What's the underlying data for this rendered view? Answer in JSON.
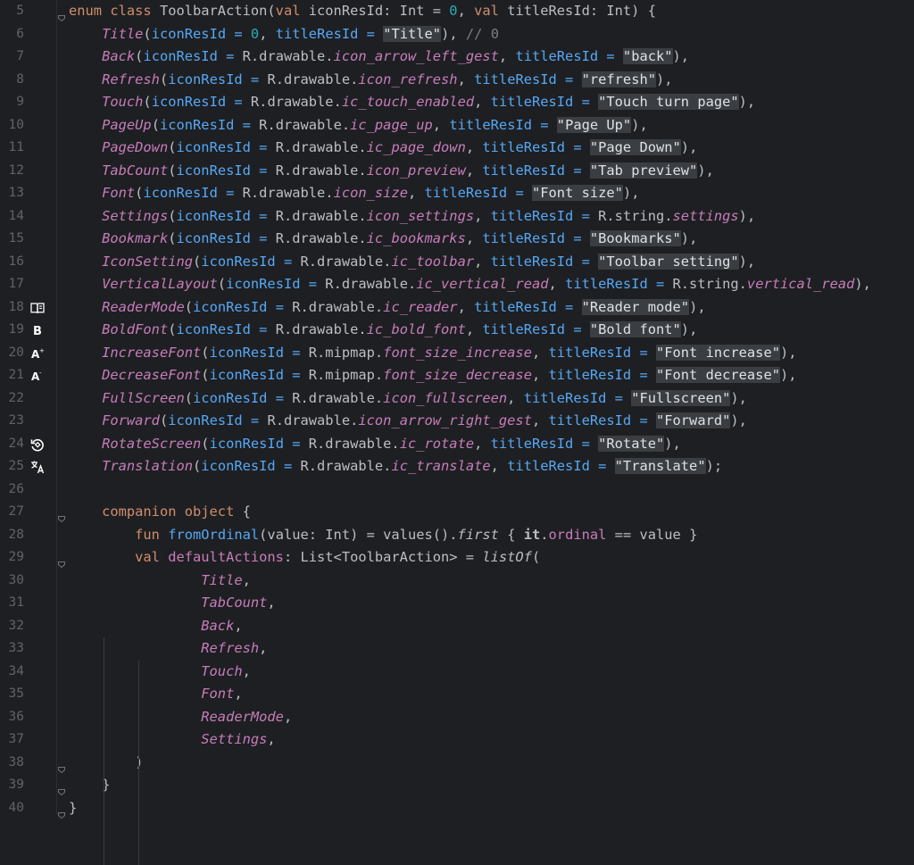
{
  "editor": {
    "lines": [
      {
        "n": "5",
        "fold": true,
        "segs": [
          [
            "kw",
            "enum class "
          ],
          [
            "plain",
            "ToolbarAction("
          ],
          [
            "kw",
            "val "
          ],
          [
            "plain",
            "iconResId: Int = "
          ],
          [
            "num",
            "0"
          ],
          [
            "plain",
            ", "
          ],
          [
            "kw",
            "val "
          ],
          [
            "plain",
            "titleResId: Int) {"
          ]
        ]
      },
      {
        "n": "6",
        "segs": [
          [
            "en",
            "Title"
          ],
          [
            "plain",
            "("
          ],
          [
            "named",
            "iconResId = "
          ],
          [
            "num",
            "0"
          ],
          [
            "plain",
            ", "
          ],
          [
            "named",
            "titleResId = "
          ],
          [
            "strx",
            "\"Title\""
          ],
          [
            "plain",
            "), "
          ],
          [
            "cm",
            "// 0"
          ]
        ]
      },
      {
        "n": "7",
        "segs": [
          [
            "en",
            "Back"
          ],
          [
            "plain",
            "("
          ],
          [
            "named",
            "iconResId = "
          ],
          [
            "plain",
            "R.drawable."
          ],
          [
            "res",
            "icon_arrow_left_gest"
          ],
          [
            "plain",
            ", "
          ],
          [
            "named",
            "titleResId = "
          ],
          [
            "strx",
            "\"back\""
          ],
          [
            "plain",
            "),"
          ]
        ]
      },
      {
        "n": "8",
        "segs": [
          [
            "en",
            "Refresh"
          ],
          [
            "plain",
            "("
          ],
          [
            "named",
            "iconResId = "
          ],
          [
            "plain",
            "R.drawable."
          ],
          [
            "res",
            "icon_refresh"
          ],
          [
            "plain",
            ", "
          ],
          [
            "named",
            "titleResId = "
          ],
          [
            "strx",
            "\"refresh\""
          ],
          [
            "plain",
            "),"
          ]
        ]
      },
      {
        "n": "9",
        "segs": [
          [
            "en",
            "Touch"
          ],
          [
            "plain",
            "("
          ],
          [
            "named",
            "iconResId = "
          ],
          [
            "plain",
            "R.drawable."
          ],
          [
            "res",
            "ic_touch_enabled"
          ],
          [
            "plain",
            ", "
          ],
          [
            "named",
            "titleResId = "
          ],
          [
            "strx",
            "\"Touch turn page\""
          ],
          [
            "plain",
            "),"
          ]
        ]
      },
      {
        "n": "10",
        "segs": [
          [
            "en",
            "PageUp"
          ],
          [
            "plain",
            "("
          ],
          [
            "named",
            "iconResId = "
          ],
          [
            "plain",
            "R.drawable."
          ],
          [
            "res",
            "ic_page_up"
          ],
          [
            "plain",
            ", "
          ],
          [
            "named",
            "titleResId = "
          ],
          [
            "strx",
            "\"Page Up\""
          ],
          [
            "plain",
            "),"
          ]
        ]
      },
      {
        "n": "11",
        "segs": [
          [
            "en",
            "PageDown"
          ],
          [
            "plain",
            "("
          ],
          [
            "named",
            "iconResId = "
          ],
          [
            "plain",
            "R.drawable."
          ],
          [
            "res",
            "ic_page_down"
          ],
          [
            "plain",
            ", "
          ],
          [
            "named",
            "titleResId = "
          ],
          [
            "strx",
            "\"Page Down\""
          ],
          [
            "plain",
            "),"
          ]
        ]
      },
      {
        "n": "12",
        "segs": [
          [
            "en",
            "TabCount"
          ],
          [
            "plain",
            "("
          ],
          [
            "named",
            "iconResId = "
          ],
          [
            "plain",
            "R.drawable."
          ],
          [
            "res",
            "icon_preview"
          ],
          [
            "plain",
            ", "
          ],
          [
            "named",
            "titleResId = "
          ],
          [
            "strx",
            "\"Tab preview\""
          ],
          [
            "plain",
            "),"
          ]
        ]
      },
      {
        "n": "13",
        "segs": [
          [
            "en",
            "Font"
          ],
          [
            "plain",
            "("
          ],
          [
            "named",
            "iconResId = "
          ],
          [
            "plain",
            "R.drawable."
          ],
          [
            "res",
            "icon_size"
          ],
          [
            "plain",
            ", "
          ],
          [
            "named",
            "titleResId = "
          ],
          [
            "strx",
            "\"Font size\""
          ],
          [
            "plain",
            "),"
          ]
        ]
      },
      {
        "n": "14",
        "segs": [
          [
            "en",
            "Settings"
          ],
          [
            "plain",
            "("
          ],
          [
            "named",
            "iconResId = "
          ],
          [
            "plain",
            "R.drawable."
          ],
          [
            "res",
            "icon_settings"
          ],
          [
            "plain",
            ", "
          ],
          [
            "named",
            "titleResId = "
          ],
          [
            "plain",
            "R.string."
          ],
          [
            "res",
            "settings"
          ],
          [
            "plain",
            "),"
          ]
        ]
      },
      {
        "n": "15",
        "segs": [
          [
            "en",
            "Bookmark"
          ],
          [
            "plain",
            "("
          ],
          [
            "named",
            "iconResId = "
          ],
          [
            "plain",
            "R.drawable."
          ],
          [
            "res",
            "ic_bookmarks"
          ],
          [
            "plain",
            ", "
          ],
          [
            "named",
            "titleResId = "
          ],
          [
            "strx",
            "\"Bookmarks\""
          ],
          [
            "plain",
            "),"
          ]
        ]
      },
      {
        "n": "16",
        "segs": [
          [
            "en",
            "IconSetting"
          ],
          [
            "plain",
            "("
          ],
          [
            "named",
            "iconResId = "
          ],
          [
            "plain",
            "R.drawable."
          ],
          [
            "res",
            "ic_toolbar"
          ],
          [
            "plain",
            ", "
          ],
          [
            "named",
            "titleResId = "
          ],
          [
            "strx",
            "\"Toolbar setting\""
          ],
          [
            "plain",
            "),"
          ]
        ]
      },
      {
        "n": "17",
        "segs": [
          [
            "en",
            "VerticalLayout"
          ],
          [
            "plain",
            "("
          ],
          [
            "named",
            "iconResId = "
          ],
          [
            "plain",
            "R.drawable."
          ],
          [
            "res",
            "ic_vertical_read"
          ],
          [
            "plain",
            ", "
          ],
          [
            "named",
            "titleResId = "
          ],
          [
            "plain",
            "R.string."
          ],
          [
            "res",
            "vertical_read"
          ],
          [
            "plain",
            "),"
          ]
        ]
      },
      {
        "n": "18",
        "icon": "book-icon",
        "segs": [
          [
            "en",
            "ReaderMode"
          ],
          [
            "plain",
            "("
          ],
          [
            "named",
            "iconResId = "
          ],
          [
            "plain",
            "R.drawable."
          ],
          [
            "res",
            "ic_reader"
          ],
          [
            "plain",
            ", "
          ],
          [
            "named",
            "titleResId = "
          ],
          [
            "strx",
            "\"Reader mode\""
          ],
          [
            "plain",
            "),"
          ]
        ]
      },
      {
        "n": "19",
        "icon": "bold-icon",
        "segs": [
          [
            "en",
            "BoldFont"
          ],
          [
            "plain",
            "("
          ],
          [
            "named",
            "iconResId = "
          ],
          [
            "plain",
            "R.drawable."
          ],
          [
            "res",
            "ic_bold_font"
          ],
          [
            "plain",
            ", "
          ],
          [
            "named",
            "titleResId = "
          ],
          [
            "strx",
            "\"Bold font\""
          ],
          [
            "plain",
            "),"
          ]
        ]
      },
      {
        "n": "20",
        "icon": "font-increase-icon",
        "segs": [
          [
            "en",
            "IncreaseFont"
          ],
          [
            "plain",
            "("
          ],
          [
            "named",
            "iconResId = "
          ],
          [
            "plain",
            "R.mipmap."
          ],
          [
            "res",
            "font_size_increase"
          ],
          [
            "plain",
            ", "
          ],
          [
            "named",
            "titleResId = "
          ],
          [
            "strx",
            "\"Font increase\""
          ],
          [
            "plain",
            "),"
          ]
        ]
      },
      {
        "n": "21",
        "icon": "font-decrease-icon",
        "segs": [
          [
            "en",
            "DecreaseFont"
          ],
          [
            "plain",
            "("
          ],
          [
            "named",
            "iconResId = "
          ],
          [
            "plain",
            "R.mipmap."
          ],
          [
            "res",
            "font_size_decrease"
          ],
          [
            "plain",
            ", "
          ],
          [
            "named",
            "titleResId = "
          ],
          [
            "strx",
            "\"Font decrease\""
          ],
          [
            "plain",
            "),"
          ]
        ]
      },
      {
        "n": "22",
        "segs": [
          [
            "en",
            "FullScreen"
          ],
          [
            "plain",
            "("
          ],
          [
            "named",
            "iconResId = "
          ],
          [
            "plain",
            "R.drawable."
          ],
          [
            "res",
            "icon_fullscreen"
          ],
          [
            "plain",
            ", "
          ],
          [
            "named",
            "titleResId = "
          ],
          [
            "strx",
            "\"Fullscreen\""
          ],
          [
            "plain",
            "),"
          ]
        ]
      },
      {
        "n": "23",
        "segs": [
          [
            "en",
            "Forward"
          ],
          [
            "plain",
            "("
          ],
          [
            "named",
            "iconResId = "
          ],
          [
            "plain",
            "R.drawable."
          ],
          [
            "res",
            "icon_arrow_right_gest"
          ],
          [
            "plain",
            ", "
          ],
          [
            "named",
            "titleResId = "
          ],
          [
            "strx",
            "\"Forward\""
          ],
          [
            "plain",
            "),"
          ]
        ]
      },
      {
        "n": "24",
        "icon": "rotate-icon",
        "segs": [
          [
            "en",
            "RotateScreen"
          ],
          [
            "plain",
            "("
          ],
          [
            "named",
            "iconResId = "
          ],
          [
            "plain",
            "R.drawable."
          ],
          [
            "res",
            "ic_rotate"
          ],
          [
            "plain",
            ", "
          ],
          [
            "named",
            "titleResId = "
          ],
          [
            "strx",
            "\"Rotate\""
          ],
          [
            "plain",
            "),"
          ]
        ]
      },
      {
        "n": "25",
        "icon": "translate-icon",
        "segs": [
          [
            "en",
            "Translation"
          ],
          [
            "plain",
            "("
          ],
          [
            "named",
            "iconResId = "
          ],
          [
            "plain",
            "R.drawable."
          ],
          [
            "res",
            "ic_translate"
          ],
          [
            "plain",
            ", "
          ],
          [
            "named",
            "titleResId = "
          ],
          [
            "strx",
            "\"Translate\""
          ],
          [
            "plain",
            ");"
          ]
        ]
      },
      {
        "n": "26",
        "segs": []
      },
      {
        "n": "27",
        "fold": true,
        "segs": [
          [
            "plain",
            "    "
          ],
          [
            "kw",
            "companion object "
          ],
          [
            "plain",
            "{"
          ]
        ]
      },
      {
        "n": "28",
        "segs": [
          [
            "plain",
            "        "
          ],
          [
            "kw",
            "fun "
          ],
          [
            "fn",
            "fromOrdinal"
          ],
          [
            "plain",
            "(value: Int) = values()."
          ],
          [
            "ital",
            "first"
          ],
          [
            "plain",
            " { "
          ],
          [
            "bold",
            "it"
          ],
          [
            "plain",
            "."
          ],
          [
            "prop",
            "ordinal"
          ],
          [
            "plain",
            " == value }"
          ]
        ]
      },
      {
        "n": "29",
        "fold": true,
        "segs": [
          [
            "plain",
            "        "
          ],
          [
            "kw",
            "val "
          ],
          [
            "prop",
            "defaultActions"
          ],
          [
            "plain",
            ": List<ToolbarAction> = "
          ],
          [
            "ital",
            "listOf"
          ],
          [
            "plain",
            "("
          ]
        ]
      },
      {
        "n": "30",
        "segs": [
          [
            "plain",
            "                "
          ],
          [
            "en",
            "Title"
          ],
          [
            "plain",
            ","
          ]
        ]
      },
      {
        "n": "31",
        "segs": [
          [
            "plain",
            "                "
          ],
          [
            "en",
            "TabCount"
          ],
          [
            "plain",
            ","
          ]
        ]
      },
      {
        "n": "32",
        "segs": [
          [
            "plain",
            "                "
          ],
          [
            "en",
            "Back"
          ],
          [
            "plain",
            ","
          ]
        ]
      },
      {
        "n": "33",
        "segs": [
          [
            "plain",
            "                "
          ],
          [
            "en",
            "Refresh"
          ],
          [
            "plain",
            ","
          ]
        ]
      },
      {
        "n": "34",
        "segs": [
          [
            "plain",
            "                "
          ],
          [
            "en",
            "Touch"
          ],
          [
            "plain",
            ","
          ]
        ]
      },
      {
        "n": "35",
        "segs": [
          [
            "plain",
            "                "
          ],
          [
            "en",
            "Font"
          ],
          [
            "plain",
            ","
          ]
        ]
      },
      {
        "n": "36",
        "segs": [
          [
            "plain",
            "                "
          ],
          [
            "en",
            "ReaderMode"
          ],
          [
            "plain",
            ","
          ]
        ]
      },
      {
        "n": "37",
        "segs": [
          [
            "plain",
            "                "
          ],
          [
            "en",
            "Settings"
          ],
          [
            "plain",
            ","
          ]
        ]
      },
      {
        "n": "38",
        "fold": true,
        "segs": [
          [
            "plain",
            "        )"
          ]
        ]
      },
      {
        "n": "39",
        "fold": true,
        "segs": [
          [
            "plain",
            "    }"
          ]
        ]
      },
      {
        "n": "40",
        "fold": true,
        "segs": [
          [
            "plain",
            "}"
          ]
        ]
      }
    ]
  },
  "colors": {
    "background": "#1e1f22",
    "keyword": "#cf8e6d",
    "enum_entry": "#c77dbb",
    "named_arg": "#56a8f5",
    "number": "#2aacb8",
    "comment": "#7a7e85",
    "string_bg": "#3a3d41"
  }
}
